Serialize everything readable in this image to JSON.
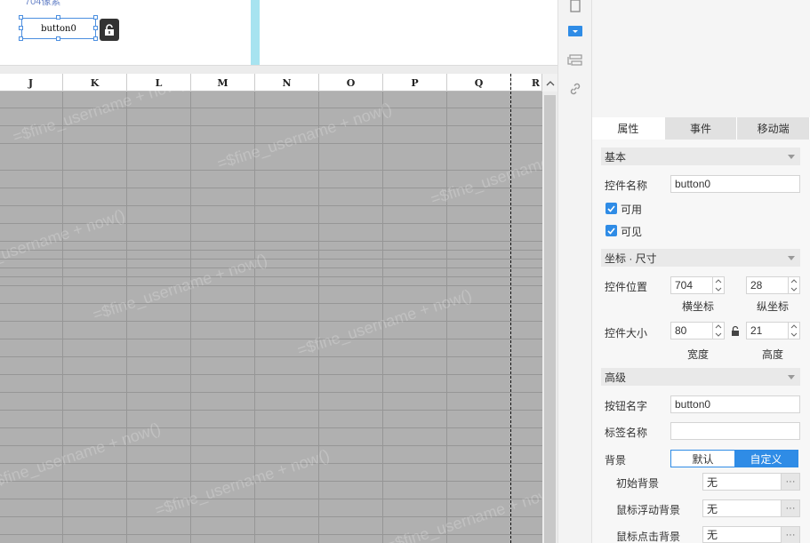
{
  "canvas": {
    "hint_text": "704像素",
    "button_text": "button0"
  },
  "sheet": {
    "columns": [
      "J",
      "K",
      "L",
      "M",
      "N",
      "O",
      "P",
      "Q",
      "R"
    ],
    "watermark": "=$fine_username + now()"
  },
  "panel": {
    "tabs": [
      {
        "label": "属性",
        "active": true
      },
      {
        "label": "事件",
        "active": false
      },
      {
        "label": "移动端",
        "active": false
      }
    ],
    "basic": {
      "section": "基本",
      "name_label": "控件名称",
      "name_value": "button0",
      "enabled_label": "可用",
      "visible_label": "可见"
    },
    "geometry": {
      "section": "坐标 · 尺寸",
      "pos_label": "控件位置",
      "x_value": "704",
      "y_value": "28",
      "x_caption": "横坐标",
      "y_caption": "纵坐标",
      "size_label": "控件大小",
      "w_value": "80",
      "h_value": "21",
      "w_caption": "宽度",
      "h_caption": "高度"
    },
    "advanced": {
      "section": "高级",
      "button_name_label": "按钮名字",
      "button_name_value": "button0",
      "tag_name_label": "标签名称",
      "tag_name_value": "",
      "background_label": "背景",
      "bg_default": "默认",
      "bg_custom": "自定义",
      "initial_bg_label": "初始背景",
      "initial_bg_value": "无",
      "hover_bg_label": "鼠标浮动背景",
      "hover_bg_value": "无",
      "click_bg_label": "鼠标点击背景",
      "click_bg_value": "无"
    }
  },
  "colors": {
    "accent": "#2f8ce6",
    "sheet_bg": "#b0b0b0",
    "scroll_cyan": "#a7e3f0"
  }
}
